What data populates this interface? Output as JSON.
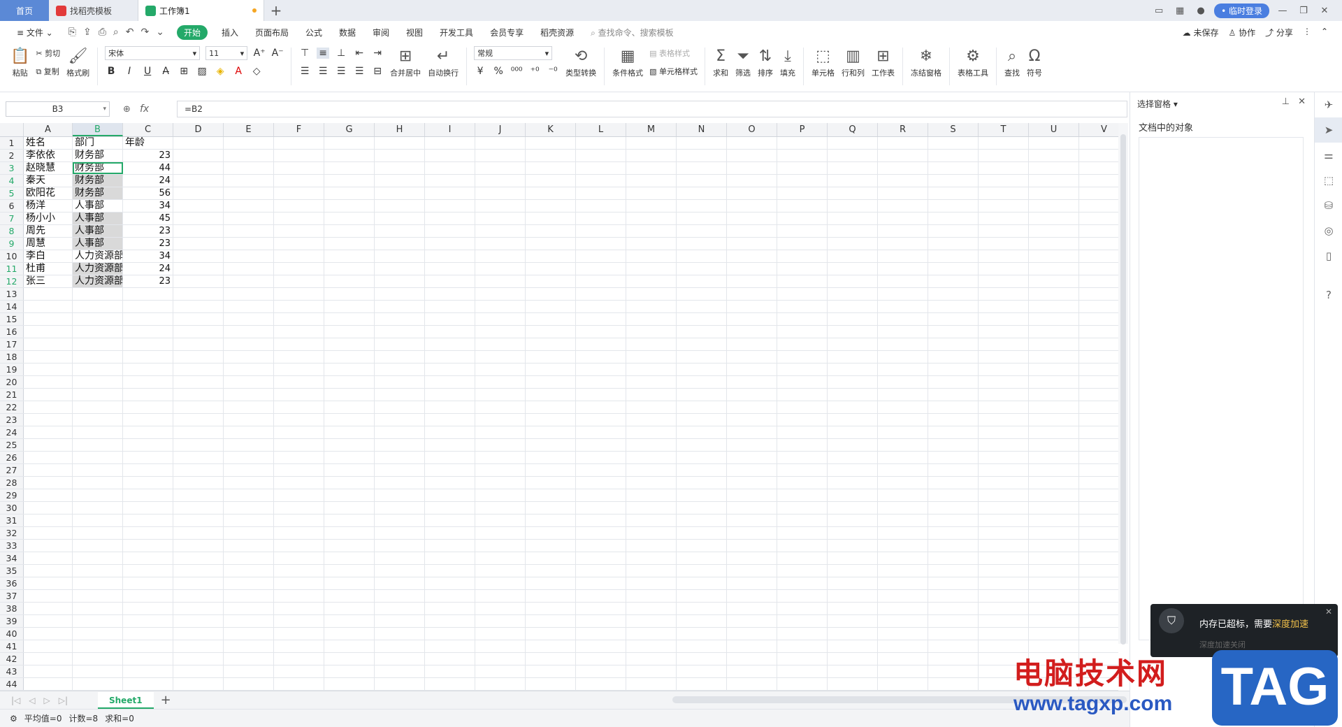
{
  "titlebar": {
    "tabs": [
      {
        "label": "首页"
      },
      {
        "label": "找稻壳模板"
      },
      {
        "label": "工作簿1"
      }
    ],
    "login_label": "• 临时登录"
  },
  "menubar": {
    "file": "≡ 文件 ⌄",
    "start": "开始",
    "items": [
      "插入",
      "页面布局",
      "公式",
      "数据",
      "审阅",
      "视图",
      "开发工具",
      "会员专享",
      "稻壳资源"
    ],
    "search": "查找命令、搜索模板",
    "unsaved": "未保存",
    "collab": "协作",
    "share": "分享"
  },
  "ribbon": {
    "paste": "粘贴",
    "cut": "剪切",
    "copy": "复制",
    "format_painter": "格式刷",
    "font_name": "宋体",
    "font_size": "11",
    "merge_center": "合并居中",
    "auto_wrap": "自动换行",
    "number_format": "常规",
    "type_convert": "类型转换",
    "cond_format": "条件格式",
    "table_style": "表格样式",
    "cell_style": "单元格样式",
    "sum": "求和",
    "filter": "筛选",
    "sort": "排序",
    "fill": "填充",
    "cell": "单元格",
    "row_col": "行和列",
    "worksheet": "工作表",
    "freeze": "冻结窗格",
    "table_tools": "表格工具",
    "find": "查找",
    "symbol": "符号"
  },
  "formula_bar": {
    "name_box": "B3",
    "formula": "=B2"
  },
  "sheet": {
    "columns": [
      "A",
      "B",
      "C",
      "D",
      "E",
      "F",
      "G",
      "H",
      "I",
      "J",
      "K",
      "L",
      "M",
      "N",
      "O",
      "P",
      "Q",
      "R",
      "S",
      "T",
      "U",
      "V"
    ],
    "rows": [
      [
        "姓名",
        "部门",
        ""
      ],
      [
        "李依依",
        "财务部",
        "23"
      ],
      [
        "赵晓慧",
        "财务部",
        "44"
      ],
      [
        "秦天",
        "财务部",
        "24"
      ],
      [
        "欧阳花",
        "财务部",
        "56"
      ],
      [
        "杨洋",
        "人事部",
        "34"
      ],
      [
        "杨小小",
        "人事部",
        "45"
      ],
      [
        "周先",
        "人事部",
        "23"
      ],
      [
        "周慧",
        "人事部",
        "23"
      ],
      [
        "李白",
        "人力资源部",
        "34"
      ],
      [
        "杜甫",
        "人力资源部",
        "24"
      ],
      [
        "张三",
        "人力资源部",
        "23"
      ]
    ],
    "header_c": "年龄",
    "total_rows": 44
  },
  "sheet_tabs": {
    "active": "Sheet1"
  },
  "statusbar": {
    "avg": "平均值=0",
    "count": "计数=8",
    "sum": "求和=0"
  },
  "right_panel": {
    "title": "选择窗格 ▾",
    "subtitle": "文档中的对象"
  },
  "notification": {
    "text_prefix": "内存已超标，需要",
    "text_highlight": "深度加速",
    "sub": "深度加速关闭"
  },
  "watermark": {
    "cn": "电脑技术网",
    "url": "www.tagxp.com",
    "tag": "TAG"
  }
}
